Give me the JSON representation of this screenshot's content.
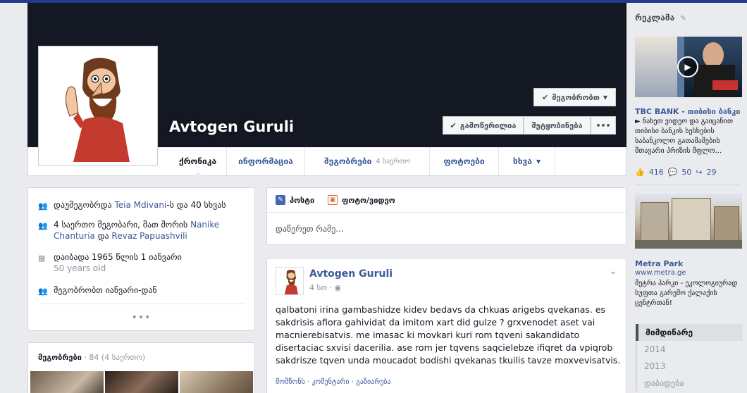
{
  "profile": {
    "name": "Avtogen Guruli",
    "friends_button": "მეგობრობთ",
    "following_button": "გამოწერილია",
    "message_button": "შეტყობინება",
    "more_button": "•••"
  },
  "tabs": [
    {
      "label": "ქრონიკა",
      "extra": ""
    },
    {
      "label": "ინფორმაცია",
      "extra": ""
    },
    {
      "label": "მეგობრები",
      "extra": "4 საერთო"
    },
    {
      "label": "ფოტოები",
      "extra": ""
    },
    {
      "label": "სხვა",
      "extra": ""
    }
  ],
  "intro": {
    "joined_prefix": "დაუმეგობრდა ",
    "joined_name": "Teia Mdivani",
    "joined_suffix": "-ს და 40 სხვას",
    "mutual_prefix": "4 საერთო მეგობარი, მათ შორის ",
    "mutual_name1": "Nanike Chanturia",
    "mutual_mid": " და ",
    "mutual_name2": "Revaz Papuashvili",
    "born": "დაიბადა 1965 წლის 1 იანვარი",
    "born_sub": "50 years old",
    "friends_since": "მეგობრობთ იანვარი-დან",
    "more": "•••"
  },
  "friends_box": {
    "title": "მეგობრები",
    "count": " · 84 (4 საერთო)"
  },
  "composer": {
    "post_tab": "პოსტი",
    "photo_tab": "ფოტო/ვიდეო",
    "placeholder": "დაწერეთ რამე..."
  },
  "post": {
    "author": "Avtogen Guruli",
    "time": "4 სთ · ",
    "text": "qalbatoni irina gambashidze kidev bedavs da chkuas arigebs qvekanas. es sakdrisis afiora gahividat da imitom xart did gulze ? grxvenodet aset vai macnierebisatvis. me imasac ki movkari kuri rom tqveni sakandidato disertaciac sxvisi dacerilia. ase rom jer tqvens saqcielebze ifiqret da vpiqrob sakdrisze tqven unda moucadot bodishi qvekanas tkuilis tavze moxvevisatvis.",
    "actions": "მომწონს · კომენტარი · გაზიარება"
  },
  "ads": {
    "title": "რეკლამა",
    "ad1_title": "TBC BANK - თიბისი ბანკი",
    "ad1_body": "► ნახეთ ვიდეო და გაიცანით თიბისი ბანკის სესხების საბანკოლო გათამაშების მთავარი პრიზის მფლო...",
    "ad1_likes": "416",
    "ad1_comments": "50",
    "ad1_shares": "29",
    "ad2_title": "Metra Park",
    "ad2_url": "www.metra.ge",
    "ad2_body": "მეტრა პარკი - ეკოლოგიურად სუფთა გარემო ქალაქის ცენტრთან!"
  },
  "years": [
    "მიმდინარე",
    "2014",
    "2013",
    "დაბადება"
  ]
}
